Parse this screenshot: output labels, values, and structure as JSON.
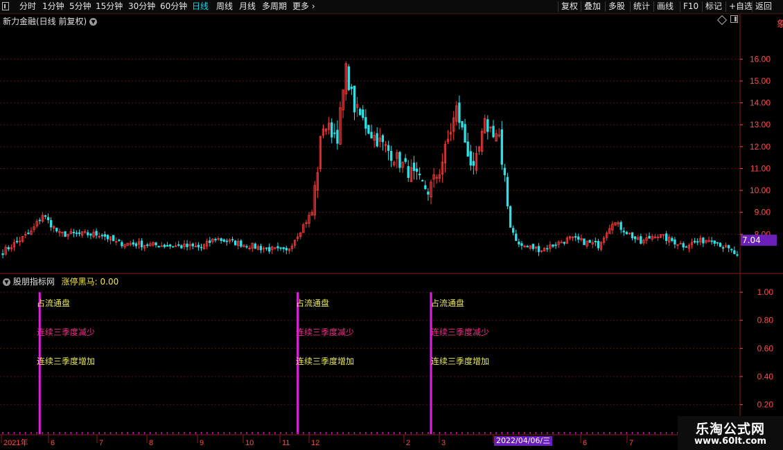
{
  "toolbar": {
    "left": [
      {
        "label": "分时",
        "active": false
      },
      {
        "label": "1分钟",
        "active": false
      },
      {
        "label": "5分钟",
        "active": false
      },
      {
        "label": "15分钟",
        "active": false
      },
      {
        "label": "30分钟",
        "active": false
      },
      {
        "label": "60分钟",
        "active": false
      },
      {
        "label": "日线",
        "active": true
      },
      {
        "label": "周线",
        "active": false
      },
      {
        "label": "月线",
        "active": false
      },
      {
        "label": "多周期",
        "active": false
      },
      {
        "label": "更多",
        "active": false
      }
    ],
    "right": [
      "复权",
      "叠加",
      "多股",
      "统计",
      "画线",
      "F10",
      "标记",
      "+自选",
      "返回"
    ]
  },
  "chart": {
    "title": "新力金融(日线 前复权)",
    "current_price": "7.04"
  },
  "indicator": {
    "name": "股朋指标网",
    "value_text": "涨停黑马: 0.00",
    "signal_labels": {
      "float_share": "占流通盘",
      "three_q_decrease": "连续三季度减少",
      "three_q_increase": "连续三季度增加"
    },
    "date_cursor": "2022/04/06/三"
  },
  "watermark": {
    "title": "乐淘公式网",
    "url": "www.60lt.com"
  },
  "colors": {
    "up": "#ff3b3b",
    "down": "#2fe0e6",
    "axis": "#ff4d4d",
    "accent": "#6a1fb8",
    "signal_bar": "#e020e0",
    "active_tab": "#19d3e6"
  },
  "chart_data": [
    {
      "type": "candlestick",
      "title": "新力金融(日线 前复权)",
      "y_ticks": [
        "16.00",
        "15.00",
        "14.00",
        "13.00",
        "12.00",
        "11.00",
        "10.00",
        "9.00",
        "8.00"
      ],
      "ylim": [
        6.3,
        17.5
      ],
      "x_ticks": [
        "2021年",
        "6",
        "7",
        "8",
        "9",
        "10",
        "11",
        "12",
        "2",
        "3",
        "5",
        "6",
        "7"
      ],
      "anchor_closes": [
        {
          "i": 0,
          "v": 7.2
        },
        {
          "i": 10,
          "v": 8.1
        },
        {
          "i": 14,
          "v": 8.9
        },
        {
          "i": 20,
          "v": 8.0
        },
        {
          "i": 35,
          "v": 8.0
        },
        {
          "i": 40,
          "v": 7.6
        },
        {
          "i": 55,
          "v": 7.5
        },
        {
          "i": 70,
          "v": 7.4
        },
        {
          "i": 75,
          "v": 7.8
        },
        {
          "i": 90,
          "v": 7.4
        },
        {
          "i": 100,
          "v": 7.2
        },
        {
          "i": 102,
          "v": 7.6
        },
        {
          "i": 106,
          "v": 8.4
        },
        {
          "i": 109,
          "v": 9.0
        },
        {
          "i": 110,
          "v": 10.1
        },
        {
          "i": 111,
          "v": 11.0
        },
        {
          "i": 112,
          "v": 12.2
        },
        {
          "i": 113,
          "v": 13.0
        },
        {
          "i": 118,
          "v": 12.5
        },
        {
          "i": 121,
          "v": 15.5
        },
        {
          "i": 124,
          "v": 13.8
        },
        {
          "i": 130,
          "v": 12.6
        },
        {
          "i": 140,
          "v": 11.3
        },
        {
          "i": 150,
          "v": 10.0
        },
        {
          "i": 154,
          "v": 10.9
        },
        {
          "i": 160,
          "v": 13.7
        },
        {
          "i": 166,
          "v": 10.8
        },
        {
          "i": 170,
          "v": 13.0
        },
        {
          "i": 175,
          "v": 12.5
        },
        {
          "i": 176,
          "v": 11.0
        },
        {
          "i": 177,
          "v": 10.4
        },
        {
          "i": 178,
          "v": 9.3
        },
        {
          "i": 179,
          "v": 8.4
        },
        {
          "i": 182,
          "v": 7.5
        },
        {
          "i": 190,
          "v": 7.3
        },
        {
          "i": 200,
          "v": 7.8
        },
        {
          "i": 210,
          "v": 7.5
        },
        {
          "i": 215,
          "v": 8.6
        },
        {
          "i": 225,
          "v": 7.6
        },
        {
          "i": 230,
          "v": 8.0
        },
        {
          "i": 240,
          "v": 7.5
        },
        {
          "i": 250,
          "v": 7.8
        },
        {
          "i": 259,
          "v": 7.04
        }
      ],
      "last_close": 7.04
    },
    {
      "type": "bar",
      "title": "股朋指标网",
      "y_ticks": [
        "1.00",
        "0.80",
        "0.60",
        "0.40",
        "0.20"
      ],
      "ylim": [
        0,
        1.05
      ],
      "series": [
        {
          "name": "涨停黑马",
          "values": [
            1.0,
            1.0,
            1.0
          ]
        }
      ],
      "signal_candle_index": [
        13,
        104,
        151
      ]
    }
  ]
}
